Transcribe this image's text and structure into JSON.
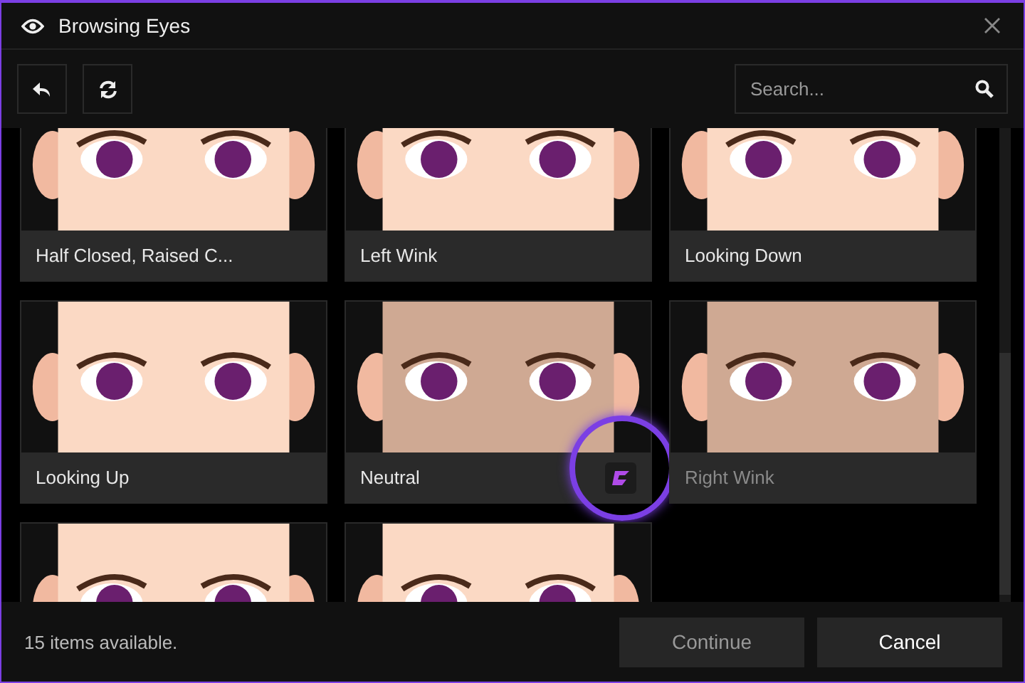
{
  "window": {
    "title": "Browsing Eyes"
  },
  "search": {
    "placeholder": "Search..."
  },
  "items": [
    {
      "label": "Half Closed, Raised C...",
      "selected": false,
      "disabled": false
    },
    {
      "label": "Left Wink",
      "selected": false,
      "disabled": false
    },
    {
      "label": "Looking Down",
      "selected": false,
      "disabled": false
    },
    {
      "label": "Looking Up",
      "selected": false,
      "disabled": false
    },
    {
      "label": "Neutral",
      "selected": true,
      "disabled": false
    },
    {
      "label": "Right Wink",
      "selected": false,
      "disabled": true
    },
    {
      "selected": false,
      "disabled": false
    },
    {
      "selected": false,
      "disabled": false
    }
  ],
  "status": "15 items available.",
  "buttons": [
    {
      "label": "Continue",
      "disabled": true
    },
    {
      "label": "Cancel",
      "disabled": false
    }
  ]
}
